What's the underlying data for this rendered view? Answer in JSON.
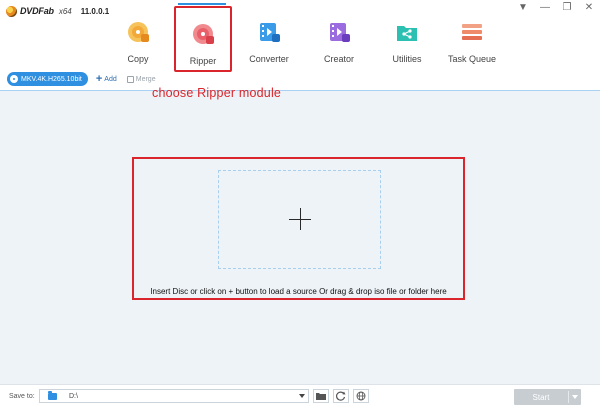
{
  "app": {
    "name": "DVDFab",
    "arch": "x64",
    "version": "11.0.0.1"
  },
  "window_controls": [
    "▼",
    "—",
    "❐",
    "✕"
  ],
  "modules": [
    {
      "label": "Copy",
      "icon": "copy-disc-icon",
      "color": "#f2b23a"
    },
    {
      "label": "Ripper",
      "icon": "ripper-disc-icon",
      "color": "#e9606a",
      "active": true
    },
    {
      "label": "Converter",
      "icon": "converter-film-icon",
      "color": "#2f8fe0"
    },
    {
      "label": "Creator",
      "icon": "creator-film-icon",
      "color": "#8a5bd8"
    },
    {
      "label": "Utilities",
      "icon": "utilities-folder-icon",
      "color": "#21b3a6"
    },
    {
      "label": "Task Queue",
      "icon": "task-queue-icon",
      "color": "#ef8a6b"
    }
  ],
  "toolbar": {
    "profile_label": "MKV.4K.H265.10bit",
    "add_label": "Add",
    "merge_label": "Merge"
  },
  "annotation": "choose Ripper module",
  "drop": {
    "hint": "Insert Disc or click on + button to load a source Or drag & drop iso file or folder here"
  },
  "bottom": {
    "save_label": "Save to:",
    "path": "D:\\",
    "start_label": "Start"
  },
  "colors": {
    "accent": "#2f8fe0",
    "highlight": "#d9252b",
    "start_disabled": "#c8cdd2"
  }
}
